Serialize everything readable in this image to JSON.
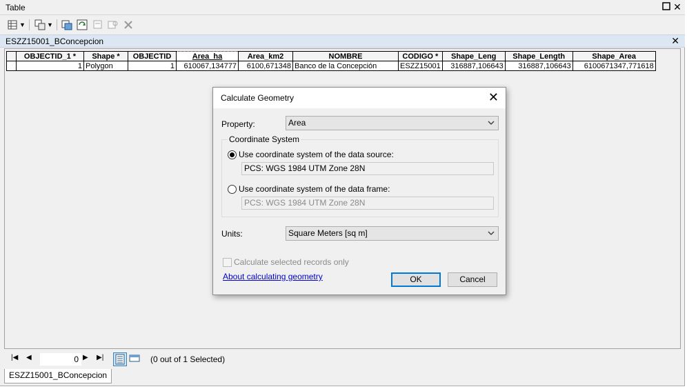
{
  "window": {
    "title": "Table",
    "restore_icon": "restore-icon",
    "close_icon": "close-icon"
  },
  "toolbar": {
    "items": [
      "table-options-icon",
      "related-tables-icon",
      "select-by-attributes-icon",
      "switch-selection-icon",
      "clear-selection-icon",
      "zoom-to-selected-icon",
      "delete-selected-icon"
    ]
  },
  "table_tab": {
    "name": "ESZZ15001_BConcepcion",
    "close_icon": "close-icon"
  },
  "table": {
    "columns": [
      "OBJECTID_1 *",
      "Shape *",
      "OBJECTID",
      "Area_ha",
      "Area_km2",
      "NOMBRE",
      "CODIGO *",
      "Shape_Leng",
      "Shape_Length",
      "Shape_Area"
    ],
    "rows": [
      [
        "1",
        "Polygon",
        "1",
        "610067,134777",
        "6100,671348",
        "Banco de la Concepción",
        "ESZZ15001",
        "316887,106643",
        "316887,106643",
        "6100671347,771618"
      ]
    ],
    "sorted_column": "Area_ha"
  },
  "status": {
    "record_value": "0",
    "selection_text": "(0 out of 1 Selected)"
  },
  "bottom_tab": {
    "label": "ESZZ15001_BConcepcion"
  },
  "dialog": {
    "title": "Calculate Geometry",
    "property_label": "Property:",
    "property_value": "Area",
    "group_label": "Coordinate System",
    "radio_source_label": "Use coordinate system of the data source:",
    "radio_source_selected": true,
    "source_cs": "PCS: WGS 1984 UTM Zone 28N",
    "radio_frame_label": "Use coordinate system of the data frame:",
    "frame_cs": "PCS: WGS 1984 UTM Zone 28N",
    "units_label": "Units:",
    "units_value": "Square Meters [sq m]",
    "checkbox_label": "Calculate selected records only",
    "help_link": "About calculating geometry",
    "ok_label": "OK",
    "cancel_label": "Cancel"
  },
  "colors": {
    "tabstrip": "#dde7f3",
    "link": "#0000cc",
    "default_button_border": "#0078d7"
  }
}
